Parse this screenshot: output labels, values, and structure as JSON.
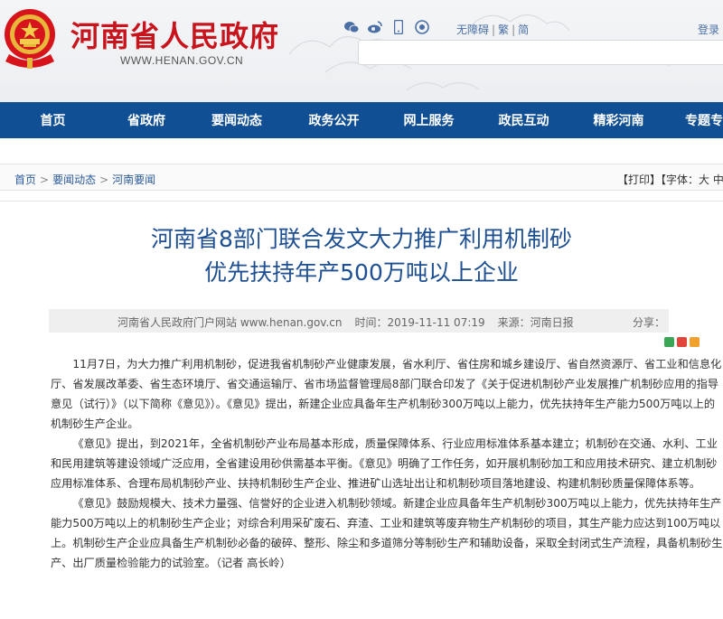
{
  "header": {
    "site_title": "河南省人民政府",
    "site_domain": "WWW.HENAN.GOV.CN",
    "tools": [
      "wechat-icon",
      "weibo-icon",
      "mobile-icon",
      "app-icon"
    ],
    "accessibility": "无障碍",
    "traditional": "繁",
    "simplified": "简",
    "login": "登录"
  },
  "nav": {
    "items": [
      "首页",
      "省政府",
      "要闻动态",
      "政务公开",
      "网上服务",
      "政民互动",
      "精彩河南",
      "专题专"
    ]
  },
  "breadcrumb": {
    "items": [
      "首页",
      "要闻动态",
      "河南要闻"
    ],
    "separator": ">"
  },
  "print_tools": "【打印】【字体：大 中",
  "article": {
    "title_line1": "河南省8部门联合发文大力推广利用机制砂",
    "title_line2": "优先扶持年产500万吨以上企业",
    "source_site": "河南省人民政府门户网站 www.henan.gov.cn",
    "time": "时间：2019-11-11 07:19",
    "source": "来源：河南日报",
    "share_label": "分享：",
    "paragraphs": [
      "11月7日，为大力推广利用机制砂，促进我省机制砂产业健康发展，省水利厅、省住房和城乡建设厅、省自然资源厅、省工业和信息化厅、省发展改革委、省生态环境厅、省交通运输厅、省市场监督管理局8部门联合印发了《关于促进机制砂产业发展推广机制砂应用的指导意见（试行）》（以下简称《意见》）。《意见》提出，新建企业应具备年生产机制砂300万吨以上能力，优先扶持年生产能力500万吨以上的机制砂生产企业。",
      "《意见》提出，到2021年，全省机制砂产业布局基本形成，质量保障体系、行业应用标准体系基本建立；机制砂在交通、水利、工业和民用建筑等建设领域广泛应用，全省建设用砂供需基本平衡。《意见》明确了工作任务，如开展机制砂加工和应用技术研究、建立机制砂应用标准体系、合理布局机制砂产业、扶持机制砂生产企业、推进矿山选址出让和机制砂项目落地建设、构建机制砂质量保障体系等。",
      "《意见》鼓励规模大、技术力量强、信誉好的企业进入机制砂领域。新建企业应具备年生产机制砂300万吨以上能力，优先扶持年生产能力500万吨以上的机制砂生产企业；对综合利用采矿废石、弃渣、工业和建筑等废弃物生产机制砂的项目，其生产能力应达到100万吨以上。机制砂生产企业应具备生产机制砂必备的破碎、整形、除尘和多道筛分等制砂生产和辅助设备，采取全封闭式生产流程，具备机制砂生产、出厂质量检验能力的试验室。（记者 高长岭）"
    ]
  },
  "colors": {
    "nav_bg": "#114f94",
    "title_red": "#c8151d",
    "article_title": "#1d4f91"
  }
}
